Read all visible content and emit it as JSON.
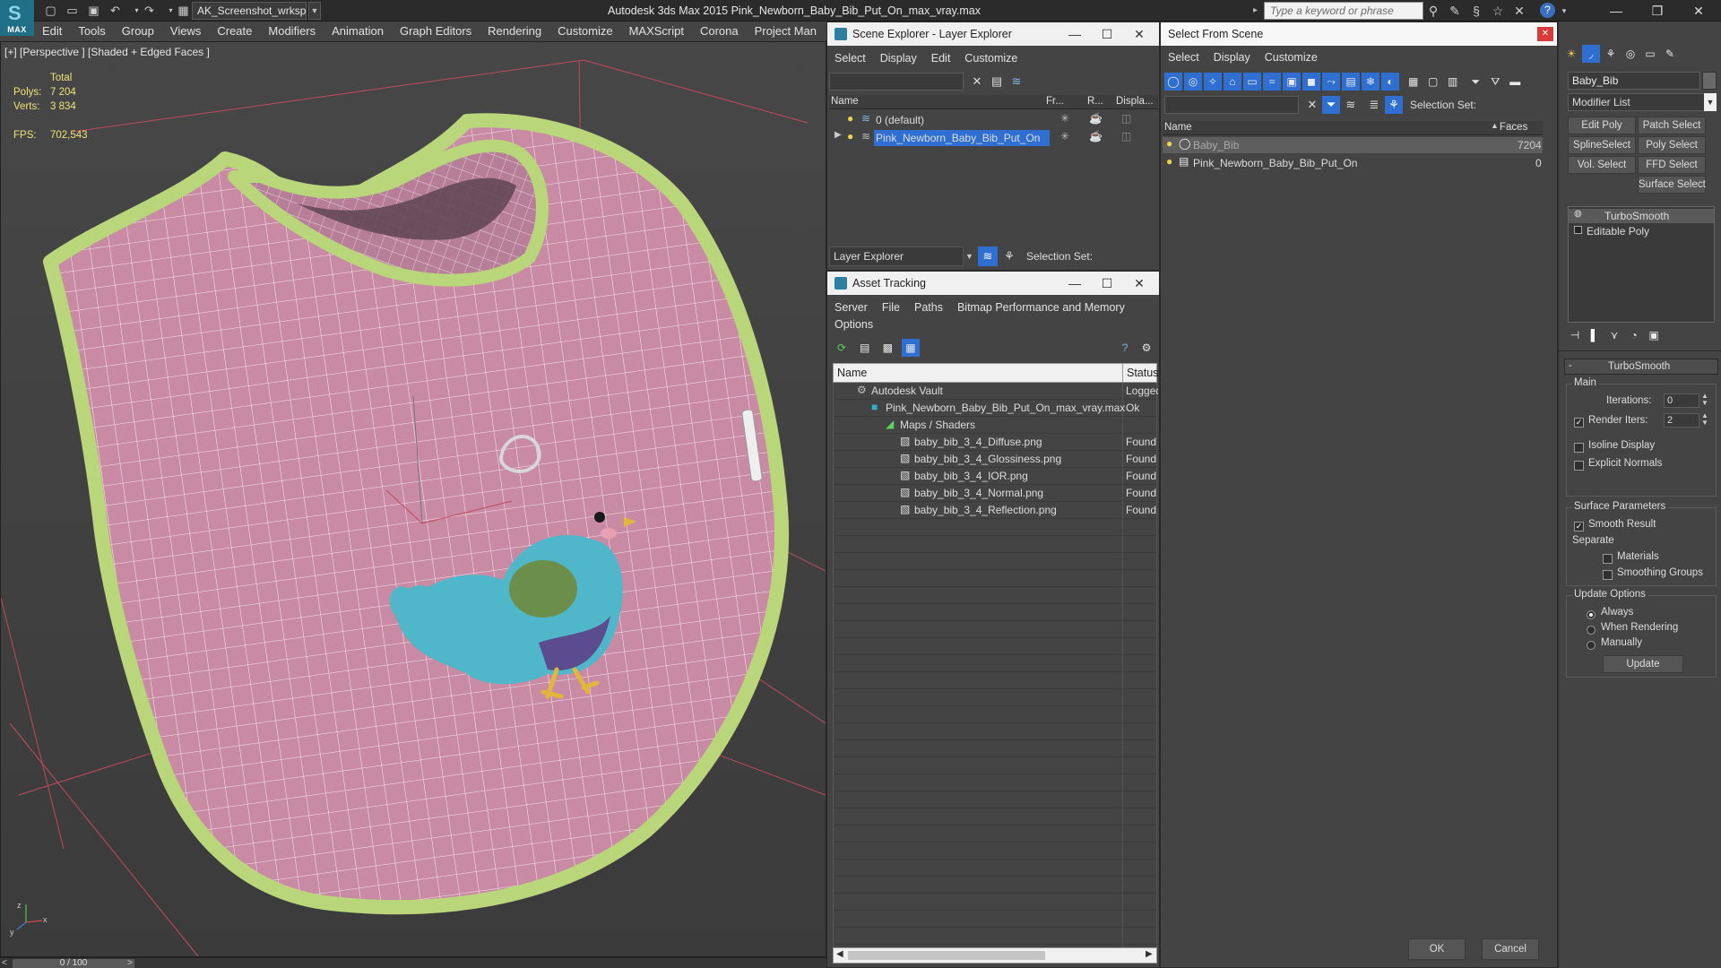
{
  "app": {
    "title": "Autodesk 3ds Max  2015    Pink_Newborn_Baby_Bib_Put_On_max_vray.max",
    "logo_label": "MAX",
    "workspace": "AK_Screenshot_wrksp",
    "search_placeholder": "Type a keyword or phrase"
  },
  "menubar": [
    "Edit",
    "Tools",
    "Group",
    "Views",
    "Create",
    "Modifiers",
    "Animation",
    "Graph Editors",
    "Rendering",
    "Customize",
    "MAXScript",
    "Corona",
    "Project Man"
  ],
  "viewport": {
    "label": "[+] [Perspective ] [Shaded + Edged Faces ]",
    "stats": {
      "total_label": "Total",
      "polys_label": "Polys:",
      "polys": "7 204",
      "verts_label": "Verts:",
      "verts": "3 834",
      "fps_label": "FPS:",
      "fps": "702,543"
    },
    "axis": {
      "x": "x",
      "y": "y",
      "z": "z"
    }
  },
  "timeline": {
    "position": "0 / 100",
    "current_frame": 0,
    "total_frames": 100,
    "prev": "<",
    "next": ">"
  },
  "scene_explorer": {
    "title": "Scene Explorer - Layer Explorer",
    "menu": [
      "Select",
      "Display",
      "Edit",
      "Customize"
    ],
    "columns": [
      "Name",
      "Fr...",
      "R...",
      "Displa..."
    ],
    "rows": [
      {
        "name": "0 (default)",
        "selected": false
      },
      {
        "name": "Pink_Newborn_Baby_Bib_Put_On",
        "selected": true
      }
    ],
    "footer_combo": "Layer Explorer",
    "selection_set_label": "Selection Set:"
  },
  "asset_tracking": {
    "title": "Asset Tracking",
    "menu": [
      "Server",
      "File",
      "Paths",
      "Bitmap Performance and Memory"
    ],
    "menu2": [
      "Options"
    ],
    "columns": [
      "Name",
      "Status"
    ],
    "rows": [
      {
        "name": "Autodesk Vault",
        "status": "Logged",
        "indent": 0,
        "icon": "vault-icon"
      },
      {
        "name": "Pink_Newborn_Baby_Bib_Put_On_max_vray.max",
        "status": "Ok",
        "indent": 1,
        "icon": "max-file-icon"
      },
      {
        "name": "Maps / Shaders",
        "status": "",
        "indent": 2,
        "icon": "maps-folder-icon"
      },
      {
        "name": "baby_bib_3_4_Diffuse.png",
        "status": "Found",
        "indent": 3,
        "icon": "bitmap-icon"
      },
      {
        "name": "baby_bib_3_4_Glossiness.png",
        "status": "Found",
        "indent": 3,
        "icon": "bitmap-icon"
      },
      {
        "name": "baby_bib_3_4_IOR.png",
        "status": "Found",
        "indent": 3,
        "icon": "bitmap-icon"
      },
      {
        "name": "baby_bib_3_4_Normal.png",
        "status": "Found",
        "indent": 3,
        "icon": "bitmap-icon"
      },
      {
        "name": "baby_bib_3_4_Reflection.png",
        "status": "Found",
        "indent": 3,
        "icon": "bitmap-icon"
      }
    ]
  },
  "select_from_scene": {
    "title": "Select From Scene",
    "menu": [
      "Select",
      "Display",
      "Customize"
    ],
    "selection_set_label": "Selection Set:",
    "columns": [
      "Name",
      "Faces"
    ],
    "rows": [
      {
        "name": "Baby_Bib",
        "faces": "7204",
        "selected": true
      },
      {
        "name": "Pink_Newborn_Baby_Bib_Put_On",
        "faces": "0",
        "selected": false
      }
    ],
    "ok": "OK",
    "cancel": "Cancel"
  },
  "command_panel": {
    "object_name": "Baby_Bib",
    "modifier_list": "Modifier List",
    "buttons": [
      "Edit Poly",
      "Patch Select",
      "SplineSelect",
      "Poly Select",
      "Vol. Select",
      "FFD Select",
      "Surface Select"
    ],
    "stack": [
      "TurboSmooth",
      "Editable Poly"
    ],
    "rollout_title": "TurboSmooth",
    "main_label": "Main",
    "iterations_label": "Iterations:",
    "iterations": "0",
    "render_iters_label": "Render Iters:",
    "render_iters": "2",
    "isoline": "Isoline Display",
    "explicit_normals": "Explicit Normals",
    "surface_params": "Surface Parameters",
    "smooth_result": "Smooth Result",
    "separate": "Separate",
    "materials": "Materials",
    "smoothing_groups": "Smoothing Groups",
    "update_options": "Update Options",
    "always": "Always",
    "when_rendering": "When Rendering",
    "manually": "Manually",
    "update": "Update"
  },
  "colors": {
    "bib_pink": "#c98aa4",
    "trim_green": "#b9d77a",
    "bird_blue": "#4fb7c9",
    "selection_blue": "#2f6fd1"
  }
}
